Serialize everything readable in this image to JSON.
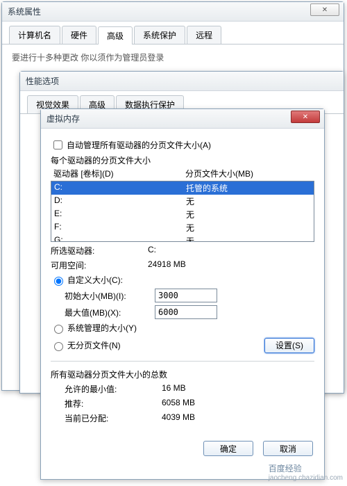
{
  "sysprops": {
    "title": "系统属性",
    "tabs": [
      "计算机名",
      "硬件",
      "高级",
      "系统保护",
      "远程"
    ],
    "active_tab": 2,
    "subtitle_fragment": "要进行十多种更改   你以须作为管理员登录"
  },
  "perf": {
    "title": "性能选项",
    "tabs": [
      "视觉效果",
      "高级",
      "数据执行保护"
    ]
  },
  "vm": {
    "title": "虚拟内存",
    "auto_manage": "自动管理所有驱动器的分页文件大小(A)",
    "auto_manage_checked": false,
    "per_drive_label": "每个驱动器的分页文件大小",
    "header_drive": "驱动器 [卷标](D)",
    "header_size": "分页文件大小(MB)",
    "drives": [
      {
        "letter": "C:",
        "value": "托管的系统",
        "selected": true
      },
      {
        "letter": "D:",
        "value": "无",
        "selected": false
      },
      {
        "letter": "E:",
        "value": "无",
        "selected": false
      },
      {
        "letter": "F:",
        "value": "无",
        "selected": false
      },
      {
        "letter": "G:",
        "value": "无",
        "selected": false
      }
    ],
    "selected_drive_label": "所选驱动器:",
    "selected_drive": "C:",
    "available_label": "可用空间:",
    "available": "24918 MB",
    "custom_size": "自定义大小(C):",
    "initial_label": "初始大小(MB)(I):",
    "initial_value": "3000",
    "max_label": "最大值(MB)(X):",
    "max_value": "6000",
    "system_managed": "系统管理的大小(Y)",
    "no_paging": "无分页文件(N)",
    "set_btn": "设置(S)",
    "totals_title": "所有驱动器分页文件大小的总数",
    "min_allowed_label": "允许的最小值:",
    "min_allowed": "16 MB",
    "recommended_label": "推荐:",
    "recommended": "6058 MB",
    "allocated_label": "当前已分配:",
    "allocated": "4039 MB",
    "ok": "确定",
    "cancel": "取消"
  },
  "watermark": {
    "line1": "百度经验",
    "line2": "jaocheng.chazidian.com"
  }
}
